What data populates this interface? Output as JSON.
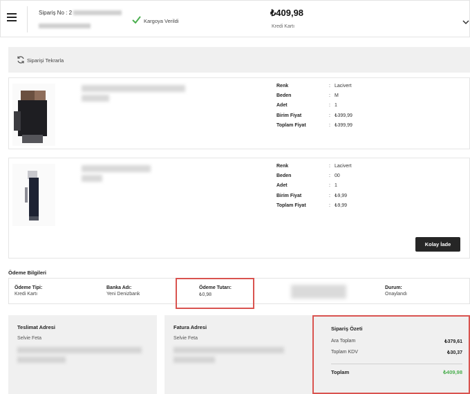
{
  "header": {
    "order_no_label": "Sipariş No : 2",
    "status": "Kargoya Verildi",
    "total": "₺409,98",
    "payment_method": "Kredi Kartı"
  },
  "reorder": {
    "label": "Siparişi Tekrarla"
  },
  "products": [
    {
      "attrs": [
        {
          "key": "Renk",
          "value": "Lacivert"
        },
        {
          "key": "Beden",
          "value": "M"
        },
        {
          "key": "Adet",
          "value": "1"
        },
        {
          "key": "Birim Fiyat",
          "value": "₺399,99"
        },
        {
          "key": "Toplam Fiyat",
          "value": "₺399,99"
        }
      ]
    },
    {
      "attrs": [
        {
          "key": "Renk",
          "value": "Lacivert"
        },
        {
          "key": "Beden",
          "value": "00"
        },
        {
          "key": "Adet",
          "value": "1"
        },
        {
          "key": "Birim Fiyat",
          "value": "₺9,99"
        },
        {
          "key": "Toplam Fiyat",
          "value": "₺9,99"
        }
      ],
      "return_button": "Kolay İade"
    }
  ],
  "payment": {
    "title": "Ödeme Bilgileri",
    "type_label": "Ödeme Tipi:",
    "type_value": "Kredi Kartı",
    "bank_label": "Banka Adı:",
    "bank_value": "Yeni Denizbank",
    "amount_label": "Ödeme Tutarı:",
    "amount_value": "₺0,98",
    "status_label": "Durum:",
    "status_value": "Onaylandı"
  },
  "delivery": {
    "title": "Teslimat Adresi",
    "name": "Selvie Feta"
  },
  "billing": {
    "title": "Fatura Adresi",
    "name": "Selvie Feta"
  },
  "summary": {
    "title": "Sipariş Özeti",
    "subtotal_label": "Ara Toplam",
    "subtotal_value": "₺379,61",
    "vat_label": "Toplam KDV",
    "vat_value": "₺30,37",
    "total_label": "Toplam",
    "total_value": "₺409,98"
  },
  "colors": {
    "accent_green": "#4caf50",
    "highlight_red": "#d9534f",
    "button_dark": "#262626"
  }
}
